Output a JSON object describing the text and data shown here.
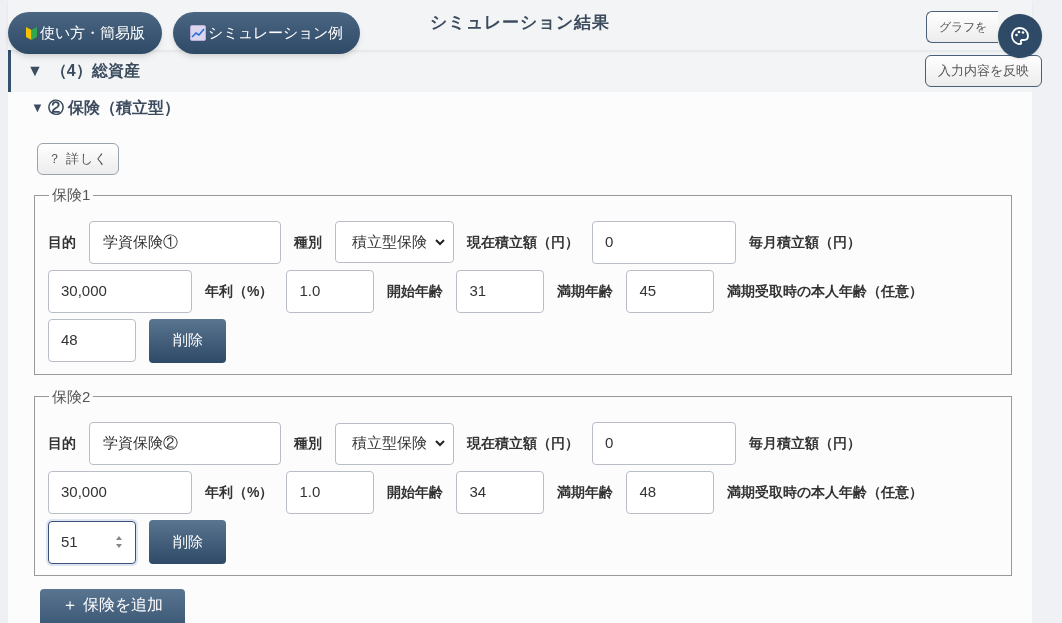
{
  "header": {
    "title": "シミュレーション結果",
    "pills": [
      {
        "kind": "beginner",
        "label": "使い方・簡易版"
      },
      {
        "kind": "chart",
        "label": "シミュレーション例"
      }
    ],
    "graph_button": "グラフを"
  },
  "section": {
    "toggle": "▼",
    "title": "（4）総資産",
    "apply_button": "入力内容を反映"
  },
  "subsection": {
    "toggle": "▼",
    "title": "② 保険（積立型）",
    "detail_button": "？ 詳しく"
  },
  "policies": [
    {
      "legend": "保険1",
      "delete_label": "削除",
      "items": [
        {
          "kind": "label",
          "text": "目的"
        },
        {
          "kind": "text",
          "value": "学資保険①",
          "focused": false
        },
        {
          "kind": "label",
          "text": "種別"
        },
        {
          "kind": "select",
          "value": "積立型保険",
          "focused": false
        },
        {
          "kind": "label",
          "text": "現在積立額（円）"
        },
        {
          "kind": "amount",
          "value": "0",
          "focused": false
        },
        {
          "kind": "label",
          "text": "毎月積立額（円）"
        },
        {
          "kind": "amount",
          "value": "30,000",
          "focused": false
        },
        {
          "kind": "label",
          "text": "年利（%）"
        },
        {
          "kind": "number",
          "value": "1.0",
          "focused": false
        },
        {
          "kind": "label",
          "text": "開始年齢"
        },
        {
          "kind": "number",
          "value": "31",
          "focused": false
        },
        {
          "kind": "label",
          "text": "満期年齢"
        },
        {
          "kind": "number",
          "value": "45",
          "focused": false
        },
        {
          "kind": "label",
          "text": "満期受取時の本人年齢（任意）"
        },
        {
          "kind": "number",
          "value": "48",
          "focused": false
        }
      ]
    },
    {
      "legend": "保険2",
      "delete_label": "削除",
      "items": [
        {
          "kind": "label",
          "text": "目的"
        },
        {
          "kind": "text",
          "value": "学資保険②",
          "focused": false
        },
        {
          "kind": "label",
          "text": "種別"
        },
        {
          "kind": "select",
          "value": "積立型保険",
          "focused": false
        },
        {
          "kind": "label",
          "text": "現在積立額（円）"
        },
        {
          "kind": "amount",
          "value": "0",
          "focused": false
        },
        {
          "kind": "label",
          "text": "毎月積立額（円）"
        },
        {
          "kind": "amount",
          "value": "30,000",
          "focused": false
        },
        {
          "kind": "label",
          "text": "年利（%）"
        },
        {
          "kind": "number",
          "value": "1.0",
          "focused": false
        },
        {
          "kind": "label",
          "text": "開始年齢"
        },
        {
          "kind": "number",
          "value": "34",
          "focused": false
        },
        {
          "kind": "label",
          "text": "満期年齢"
        },
        {
          "kind": "number",
          "value": "48",
          "focused": false
        },
        {
          "kind": "label",
          "text": "満期受取時の本人年齢（任意）"
        },
        {
          "kind": "number",
          "value": "51",
          "focused": true
        }
      ]
    }
  ],
  "add_button": "＋ 保険を追加"
}
